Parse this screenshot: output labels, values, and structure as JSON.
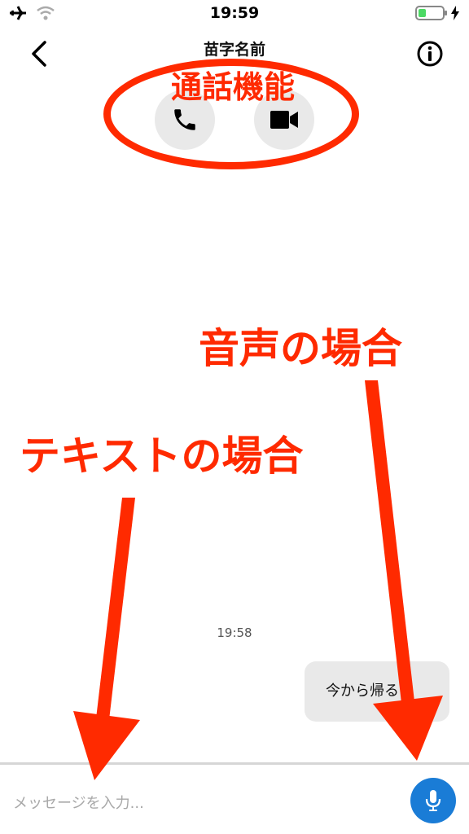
{
  "status_bar": {
    "time": "19:59",
    "icons": [
      "airplane-icon",
      "wifi-icon",
      "battery-icon",
      "charging-icon"
    ]
  },
  "header": {
    "contact_name": "苗字名前",
    "back_icon": "chevron-left-icon",
    "info_icon": "info-icon"
  },
  "call_buttons": [
    {
      "icon": "phone-icon"
    },
    {
      "icon": "video-camera-icon"
    }
  ],
  "annotations": {
    "call_feature": "通話機能",
    "voice_case": "音声の場合",
    "text_case": "テキストの場合",
    "color": "#ff2a00"
  },
  "conversation": {
    "timestamp": "19:58",
    "messages": [
      {
        "text": "今から帰るよ",
        "direction": "outgoing"
      }
    ]
  },
  "input_bar": {
    "placeholder": "メッセージを入力...",
    "value": "",
    "mic_icon": "microphone-icon",
    "mic_color": "#1a7cd6"
  }
}
